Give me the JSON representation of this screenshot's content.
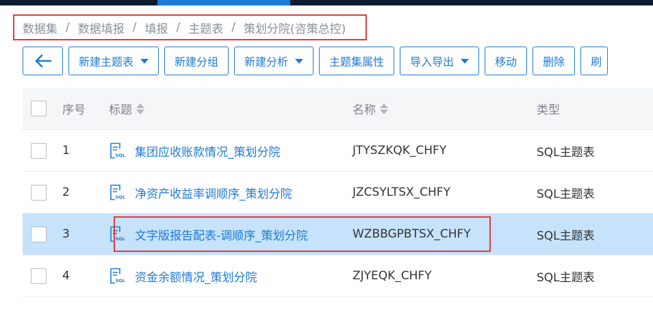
{
  "breadcrumb": [
    "数据集",
    "数据填报",
    "填报",
    "主题表",
    "策划分院(咨策总控)"
  ],
  "toolbar": {
    "back_icon": "arrow-left-icon",
    "buttons": [
      {
        "label": "新建主题表",
        "dropdown": true
      },
      {
        "label": "新建分组",
        "dropdown": false
      },
      {
        "label": "新建分析",
        "dropdown": true
      },
      {
        "label": "主题集属性",
        "dropdown": false
      },
      {
        "label": "导入导出",
        "dropdown": true
      },
      {
        "label": "移动",
        "dropdown": false
      },
      {
        "label": "删除",
        "dropdown": false
      },
      {
        "label": "刷",
        "dropdown": false
      }
    ]
  },
  "table": {
    "headers": {
      "no": "序号",
      "title": "标题",
      "name": "名称",
      "type": "类型"
    },
    "rows": [
      {
        "no": "1",
        "title": "集团应收账款情况_策划分院",
        "name": "JTYSZKQK_CHFY",
        "type": "SQL主题表",
        "selected": false
      },
      {
        "no": "2",
        "title": "净资产收益率调顺序_策划分院",
        "name": "JZCSYLTSX_CHFY",
        "type": "SQL主题表",
        "selected": false
      },
      {
        "no": "3",
        "title": "文字版报告配表-调顺序_策划分院",
        "name": "WZBBGPBTSX_CHFY",
        "type": "SQL主题表",
        "selected": true
      },
      {
        "no": "4",
        "title": "资金余额情况_策划分院",
        "name": "ZJYEQK_CHFY",
        "type": "SQL主题表",
        "selected": false
      }
    ]
  },
  "colors": {
    "accent": "#1f7ad6",
    "highlight": "#e0393e",
    "selected_row": "#c6e3fb",
    "topbar": "#0f1b33"
  },
  "row_icon": "sql-file-icon"
}
